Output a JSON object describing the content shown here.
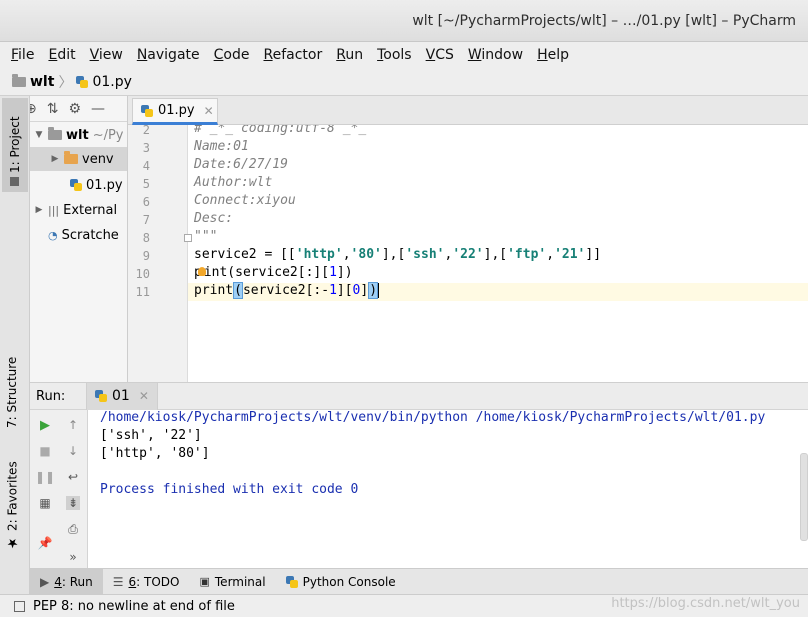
{
  "window": {
    "title": "wlt [~/PycharmProjects/wlt] – …/01.py [wlt] – PyCharm"
  },
  "menu": [
    "File",
    "Edit",
    "View",
    "Navigate",
    "Code",
    "Refactor",
    "Run",
    "Tools",
    "VCS",
    "Window",
    "Help"
  ],
  "navbar": {
    "project": "wlt",
    "file": "01.py"
  },
  "side_tabs": {
    "project": "1: Project",
    "structure": "7: Structure",
    "favorites": "2: Favorites"
  },
  "project_tree": {
    "root_name": "wlt",
    "root_path": "~/Py",
    "venv": "venv",
    "file": "01.py",
    "external": "External",
    "scratches": "Scratche"
  },
  "editor": {
    "tab_label": "01.py",
    "lines": [
      {
        "n": "2",
        "html": "<span class='cmt'># _*_ coding:utf-8 _*_</span>"
      },
      {
        "n": "3",
        "html": "<span class='cmt'>Name:01</span>"
      },
      {
        "n": "4",
        "html": "<span class='cmt'>Date:6/27/19</span>"
      },
      {
        "n": "5",
        "html": "<span class='cmt'>Author:wlt</span>"
      },
      {
        "n": "6",
        "html": "<span class='cmt'>Connect:xiyou</span>"
      },
      {
        "n": "7",
        "html": "<span class='cmt'>Desc:</span>"
      },
      {
        "n": "8",
        "html": "<span class='cmt'>\"\"\"</span>"
      },
      {
        "n": "9",
        "html": "service2 = [[<span class='str'>'http'</span>,<span class='str'>'80'</span>],[<span class='str'>'ssh'</span>,<span class='str'>'22'</span>],[<span class='str'>'ftp'</span>,<span class='str'>'21'</span>]]"
      },
      {
        "n": "10",
        "html": "p<span class='bulb'></span>int(service2[:][<span class='num'>1</span>])"
      },
      {
        "n": "11",
        "html": "print<span class='bracket'>(</span>service2[:-<span class='num'>1</span>][<span class='num'>0</span>]<span class='bracket'>)</span><span class='caret'></span>"
      }
    ]
  },
  "run": {
    "label": "Run:",
    "tab": "01",
    "output": [
      {
        "cls": "cmd",
        "text": "/home/kiosk/PycharmProjects/wlt/venv/bin/python /home/kiosk/PycharmProjects/wlt/01.py"
      },
      {
        "cls": "",
        "text": "['ssh', '22']"
      },
      {
        "cls": "",
        "text": "['http', '80']"
      },
      {
        "cls": "",
        "text": ""
      },
      {
        "cls": "done",
        "text": "Process finished with exit code 0"
      }
    ]
  },
  "bottom_tabs": {
    "run_key": "4",
    "run_text": ": Run",
    "todo_key": "6",
    "todo_text": ": TODO",
    "terminal": "Terminal",
    "console": "Python Console"
  },
  "status": {
    "message": "PEP 8: no newline at end of file"
  },
  "watermark": "https://blog.csdn.net/wlt_you"
}
